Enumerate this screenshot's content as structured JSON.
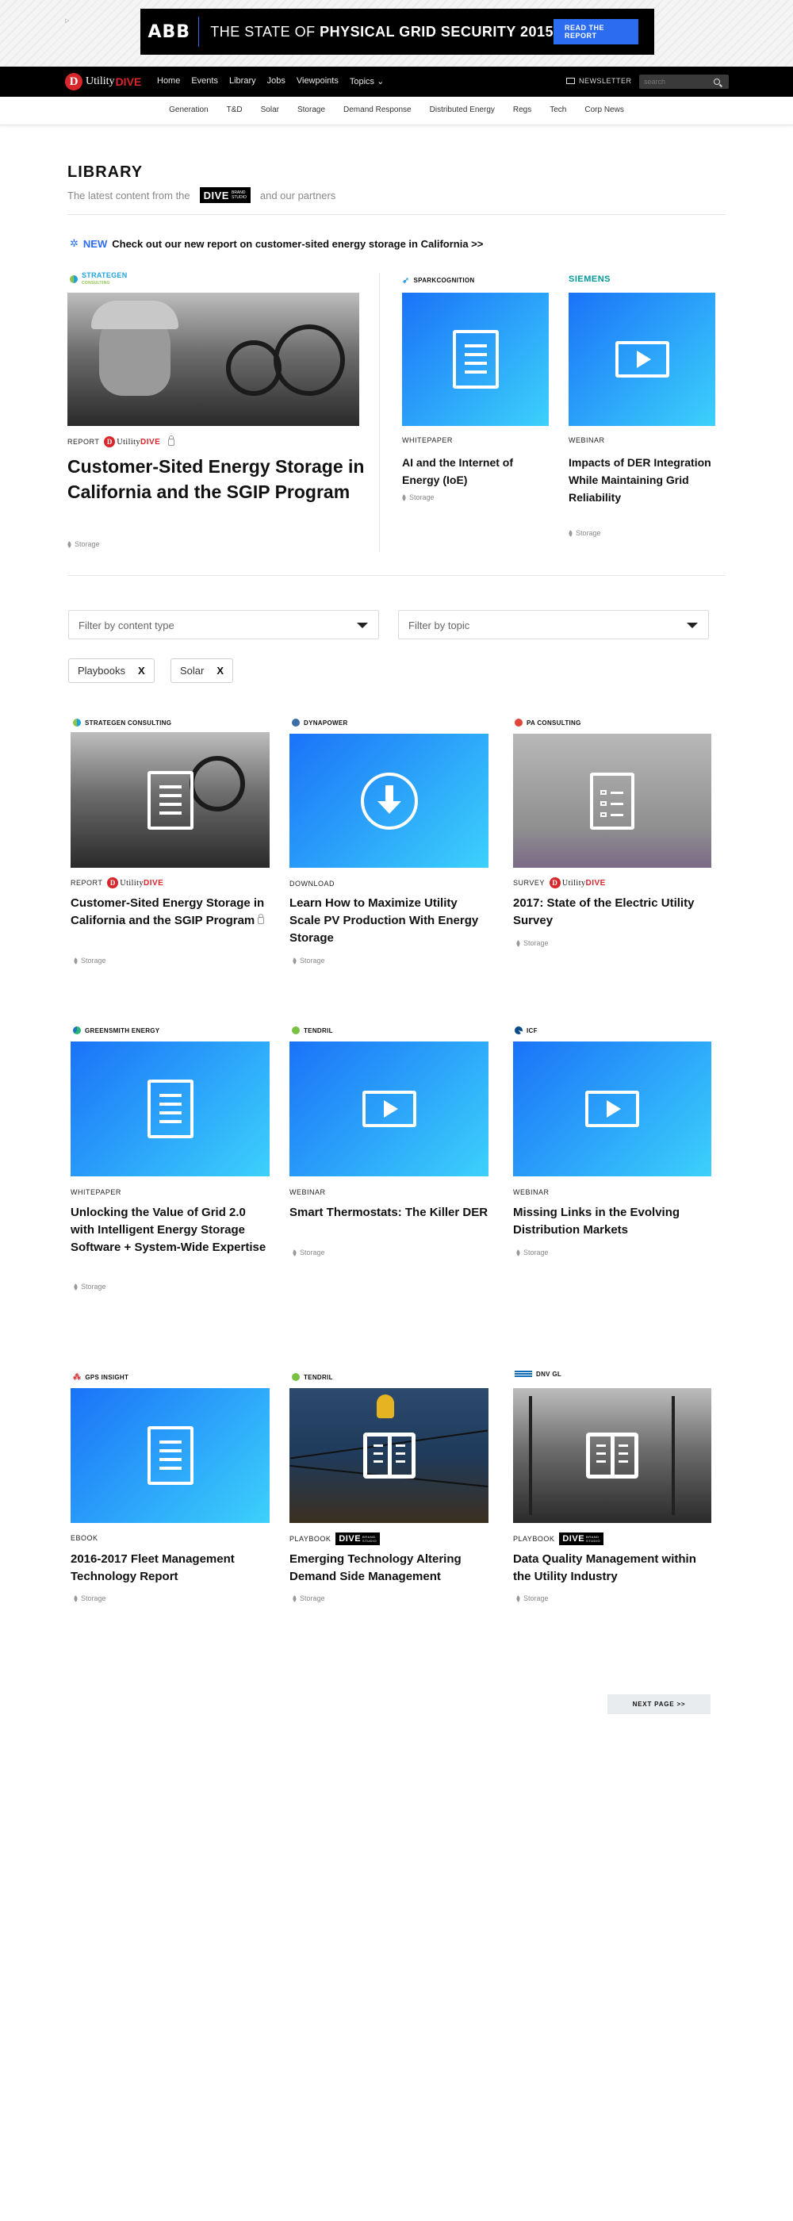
{
  "ad": {
    "choices": "▷",
    "brand": "ABB",
    "headline_light": "THE STATE OF ",
    "headline_bold": "PHYSICAL GRID SECURITY 2015",
    "button": "READ THE REPORT"
  },
  "nav": {
    "brand_d": "D",
    "brand_utility": "Utility",
    "brand_dive": "DIVE",
    "links": [
      "Home",
      "Events",
      "Library",
      "Jobs",
      "Viewpoints",
      "Topics ⌄"
    ],
    "newsletter": "NEWSLETTER",
    "search_placeholder": "search"
  },
  "subnav": [
    "Generation",
    "T&D",
    "Solar",
    "Storage",
    "Demand Response",
    "Distributed Energy",
    "Regs",
    "Tech",
    "Corp News"
  ],
  "library": {
    "title": "LIBRARY",
    "sub_before": "The latest content from the",
    "badge_dive": "DIVE",
    "badge_brand": "BRAND",
    "badge_studio": "STUDIO",
    "sub_after": "and our partners"
  },
  "promo": {
    "new": "NEW",
    "text": "Check out our new report on customer-sited energy storage in California >>"
  },
  "featured": {
    "main": {
      "sponsor": "STRATEGEN",
      "sponsor_sub": "CONSULTING",
      "type": "REPORT",
      "title": "Customer-Sited Energy Storage in California and the SGIP Program",
      "tag": "Storage"
    },
    "side": [
      {
        "sponsor": "SPARKCOGNITION",
        "type": "WHITEPAPER",
        "title": "AI and the Internet of Energy (IoE)",
        "tag": "Storage"
      },
      {
        "sponsor": "SIEMENS",
        "type": "WEBINAR",
        "title": "Impacts of DER Integration While Maintaining Grid Reliability",
        "tag": "Storage"
      }
    ]
  },
  "filters": {
    "content_type": "Filter by content type",
    "topic": "Filter by topic",
    "chips": [
      {
        "label": "Playbooks",
        "x": "X"
      },
      {
        "label": "Solar",
        "x": "X"
      }
    ]
  },
  "cards": [
    {
      "sponsor": "STRATEGEN CONSULTING",
      "type": "REPORT",
      "title": "Customer-Sited Energy Storage in California and the SGIP Program",
      "tag": "Storage"
    },
    {
      "sponsor": "DYNAPOWER",
      "type": "DOWNLOAD",
      "title": "Learn How to Maximize Utility Scale PV Production With Energy Storage",
      "tag": "Storage"
    },
    {
      "sponsor": "PA CONSULTING",
      "type": "SURVEY",
      "title": "2017: State of the Electric Utility Survey",
      "tag": "Storage"
    },
    {
      "sponsor": "GREENSMITH ENERGY",
      "type": "WHITEPAPER",
      "title": "Unlocking the Value of Grid 2.0 with Intelligent Energy Storage Software + System-Wide Expertise",
      "tag": "Storage"
    },
    {
      "sponsor": "TENDRIL",
      "type": "WEBINAR",
      "title": "Smart Thermostats: The Killer DER",
      "tag": "Storage"
    },
    {
      "sponsor": "ICF",
      "type": "WEBINAR",
      "title": "Missing Links in the Evolving Distribution Markets",
      "tag": "Storage"
    },
    {
      "sponsor": "GPS INSIGHT",
      "type": "EBOOK",
      "title": "2016-2017 Fleet Management Technology Report",
      "tag": "Storage"
    },
    {
      "sponsor": "TENDRIL",
      "type": "PLAYBOOK",
      "title": "Emerging Technology Altering Demand Side Management",
      "tag": "Storage"
    },
    {
      "sponsor": "DNV GL",
      "type": "PLAYBOOK",
      "title": "Data Quality Management within the Utility Industry",
      "tag": "Storage"
    }
  ],
  "pagination": {
    "next": "NEXT PAGE >>"
  },
  "colors": {
    "accent": "#2b6cf0",
    "brand_red": "#d8262b",
    "grad_start": "#1a73f8",
    "grad_end": "#3cd1fb"
  }
}
